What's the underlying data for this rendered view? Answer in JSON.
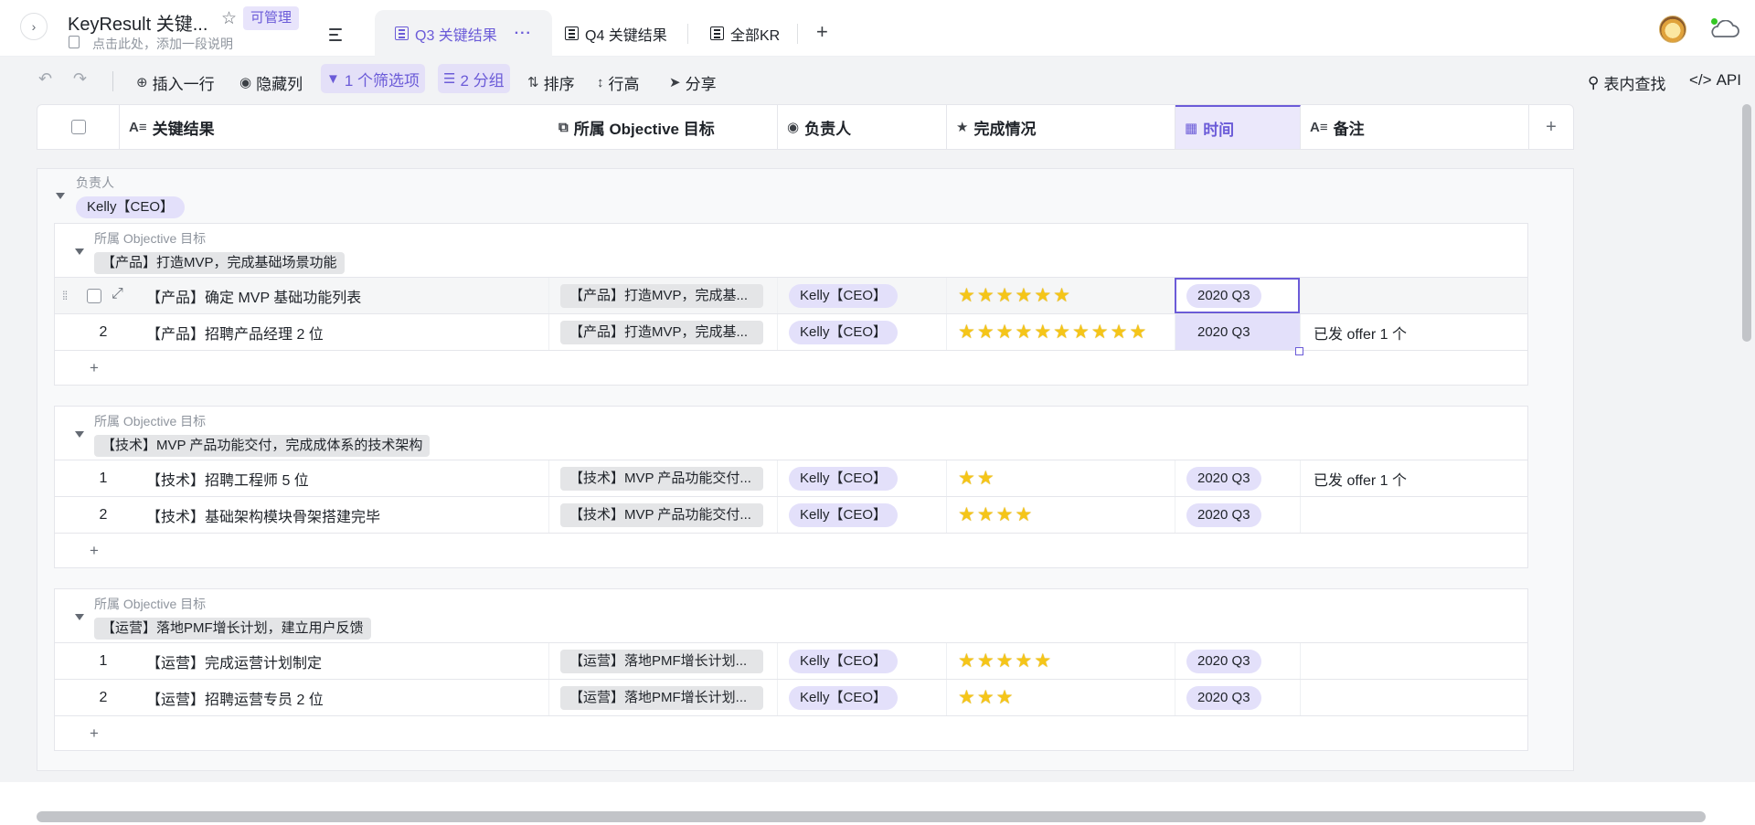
{
  "header": {
    "doc_title": "KeyResult 关键...",
    "manage_badge": "可管理",
    "doc_desc": "点击此处，添加一段说明",
    "tabs": [
      {
        "label": "Q3 关键结果",
        "more": "···"
      },
      {
        "label": "Q4 关键结果"
      },
      {
        "label": "全部KR"
      }
    ],
    "add_tab": "+"
  },
  "toolbar": {
    "insert_row": "插入一行",
    "hide_cols": "隐藏列",
    "filter": "1 个筛选项",
    "group": "2 分组",
    "sort": "排序",
    "row_height": "行高",
    "share": "分享",
    "find": "表内查找",
    "api": "API"
  },
  "columns": [
    {
      "label": "关键结果",
      "icon": "text-field-icon"
    },
    {
      "label": "所属 Objective 目标",
      "icon": "link-field-icon"
    },
    {
      "label": "负责人",
      "icon": "single-select-icon"
    },
    {
      "label": "完成情况",
      "icon": "rating-star-icon"
    },
    {
      "label": "时间",
      "icon": "date-field-icon"
    },
    {
      "label": "备注",
      "icon": "text-field-icon"
    }
  ],
  "add_column": "+",
  "group_level1": {
    "field_label": "负责人",
    "value": "Kelly【CEO】"
  },
  "subgroups": [
    {
      "field_label": "所属 Objective 目标",
      "value": "【产品】打造MVP，完成基础场景功能",
      "rows": [
        {
          "num": "",
          "kr": "【产品】确定 MVP 基础功能列表",
          "objective": "【产品】打造MVP，完成基...",
          "owner": "Kelly【CEO】",
          "stars": 6,
          "time": "2020 Q3",
          "note": ""
        },
        {
          "num": "2",
          "kr": "【产品】招聘产品经理 2 位",
          "objective": "【产品】打造MVP，完成基...",
          "owner": "Kelly【CEO】",
          "stars": 10,
          "time": "2020 Q3",
          "note": "已发 offer 1 个"
        }
      ],
      "add": "+"
    },
    {
      "field_label": "所属 Objective 目标",
      "value": "【技术】MVP 产品功能交付，完成成体系的技术架构",
      "rows": [
        {
          "num": "1",
          "kr": "【技术】招聘工程师 5 位",
          "objective": "【技术】MVP 产品功能交付...",
          "owner": "Kelly【CEO】",
          "stars": 2,
          "time": "2020 Q3",
          "note": "已发 offer 1 个"
        },
        {
          "num": "2",
          "kr": "【技术】基础架构模块骨架搭建完毕",
          "objective": "【技术】MVP 产品功能交付...",
          "owner": "Kelly【CEO】",
          "stars": 4,
          "time": "2020 Q3",
          "note": ""
        }
      ],
      "add": "+"
    },
    {
      "field_label": "所属 Objective 目标",
      "value": "【运营】落地PMF增长计划，建立用户反馈",
      "rows": [
        {
          "num": "1",
          "kr": "【运营】完成运营计划制定",
          "objective": "【运营】落地PMF增长计划...",
          "owner": "Kelly【CEO】",
          "stars": 5,
          "time": "2020 Q3",
          "note": ""
        },
        {
          "num": "2",
          "kr": "【运营】招聘运营专员 2 位",
          "objective": "【运营】落地PMF增长计划...",
          "owner": "Kelly【CEO】",
          "stars": 3,
          "time": "2020 Q3",
          "note": ""
        }
      ],
      "add": "+"
    }
  ],
  "colors": {
    "accent": "#6b5bd8",
    "accent_light": "#e3e0fa",
    "star": "#f5c518",
    "online": "#34c724"
  }
}
